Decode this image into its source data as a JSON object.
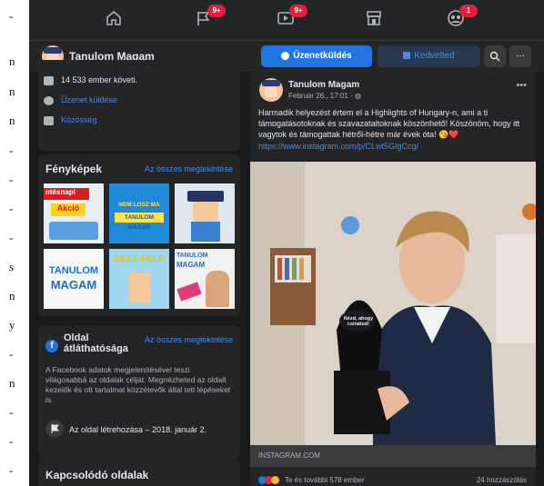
{
  "left_strip": {
    "chars": [
      "-",
      "n",
      "n",
      "n",
      "-",
      "-",
      "-",
      "-",
      "s",
      "n",
      "y",
      "-",
      "n",
      "-",
      "-",
      "-"
    ]
  },
  "topnav": {
    "icons": [
      "home-icon",
      "flag-icon",
      "video-icon",
      "store-icon",
      "groups-icon"
    ],
    "badges": {
      "flag": "9+",
      "video": "9+",
      "groups": "1"
    }
  },
  "pagebar": {
    "page_name": "Tanulom Magam",
    "message_button": "Üzenetküldés",
    "like_button": "Kedvelted",
    "more_label": "···"
  },
  "about": {
    "followers": "14 533 ember követi.",
    "send_message": "Üzenet küldése",
    "category": "Közösség"
  },
  "photos": {
    "title": "Fényképek",
    "see_all": "Az összes megtekintése",
    "tiles": [
      {
        "caption_top": "ntésnapi",
        "caption_bottom": "Akció"
      },
      {
        "caption_top": "NEM LOSZ MA",
        "caption_bottom": "TANULOM MAGAM"
      },
      {
        "caption_top": "",
        "caption_bottom": ""
      },
      {
        "caption_top": "TANULOM",
        "caption_bottom": "MAGAM"
      },
      {
        "caption_top": "DEZZ-FELE",
        "caption_bottom": ""
      },
      {
        "caption_top": "TANULOM",
        "caption_bottom": "MAGAM"
      }
    ]
  },
  "transparency": {
    "title_line1": "Oldal",
    "title_line2": "átláthatósága",
    "see_all": "Az összes megtekintése",
    "description": "A Facebook adatok megjelenítésével teszi világosabbá az oldalak célját. Megnézheted az oldalt kezelők és ott tartalmat közzétevők által tett lépéseket is.",
    "created": "Az oldal létrehozása – 2018. január 2."
  },
  "related": {
    "title": "Kapcsolódó oldalak"
  },
  "post": {
    "author": "Tanulom Magam",
    "date": "Február 26., 17:01 · ",
    "text": "Harmadik helyezést értem el a Highlights of Hungary-n, ami a ti támogatásotoknak és szavazataitoknak köszönhető! Köszönöm, hogy itt vagytok és támogattak hétről-hétre már évek óta! 😘❤️",
    "url": "https://www.instagram.com/p/CLwt5GIgCcg/",
    "source": "INSTAGRAM.COM",
    "reactions": "Te és további 578 ember",
    "comments": "24 hozzászólás",
    "trophy_text": "Nézd, ahogy csinálod!"
  },
  "colors": {
    "background": "#18191a",
    "card": "#242526",
    "accent": "#2374e1",
    "badge": "#e41e3f",
    "text": "#e4e6eb",
    "secondary_text": "#b0b3b8"
  }
}
